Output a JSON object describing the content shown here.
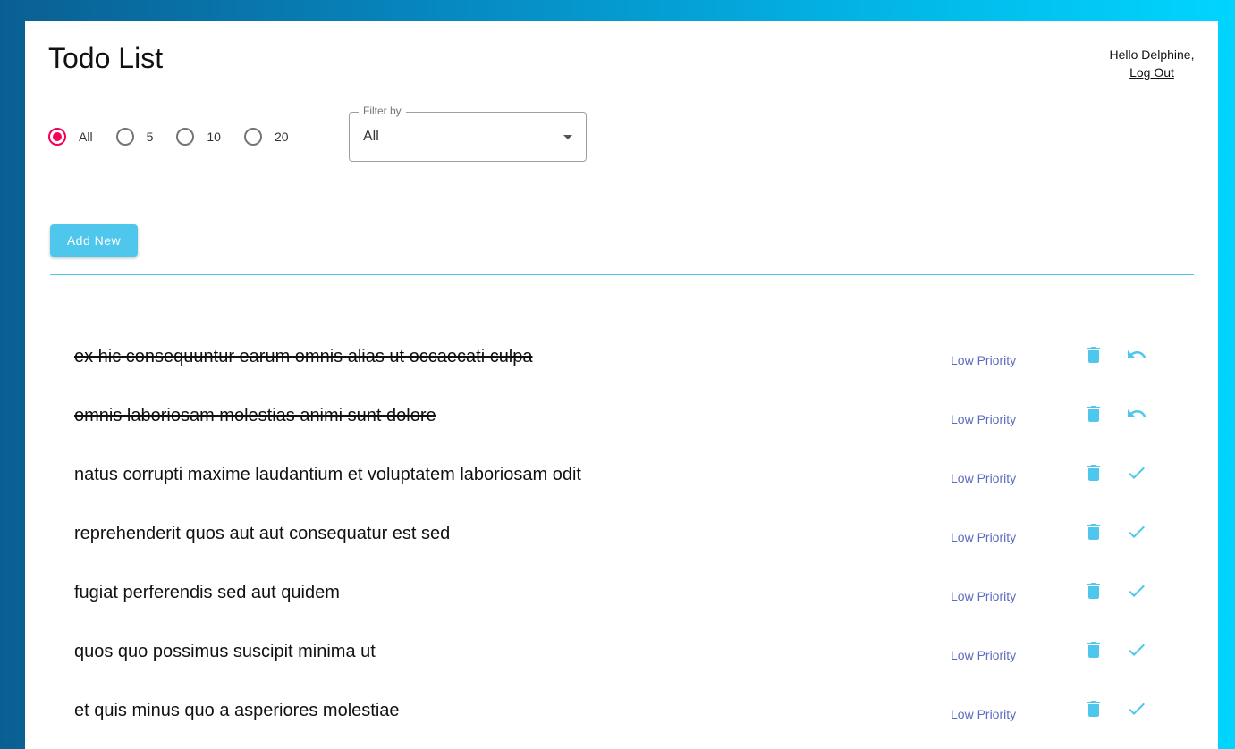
{
  "header": {
    "title": "Todo List",
    "greeting": "Hello Delphine,",
    "logout_label": "Log Out"
  },
  "filters": {
    "radios": [
      {
        "label": "All",
        "checked": true
      },
      {
        "label": "5",
        "checked": false
      },
      {
        "label": "10",
        "checked": false
      },
      {
        "label": "20",
        "checked": false
      }
    ],
    "select": {
      "legend": "Filter by",
      "value": "All"
    }
  },
  "actions": {
    "add_label": "Add New"
  },
  "todos": [
    {
      "text": "ex hic consequuntur earum omnis alias ut occaecati culpa",
      "priority": "Low Priority",
      "completed": true,
      "action_icon": "undo-icon"
    },
    {
      "text": "omnis laboriosam molestias animi sunt dolore",
      "priority": "Low Priority",
      "completed": true,
      "action_icon": "undo-icon"
    },
    {
      "text": "natus corrupti maxime laudantium et voluptatem laboriosam odit",
      "priority": "Low Priority",
      "completed": false,
      "action_icon": "check-icon"
    },
    {
      "text": "reprehenderit quos aut aut consequatur est sed",
      "priority": "Low Priority",
      "completed": false,
      "action_icon": "check-icon"
    },
    {
      "text": "fugiat perferendis sed aut quidem",
      "priority": "Low Priority",
      "completed": false,
      "action_icon": "check-icon"
    },
    {
      "text": "quos quo possimus suscipit minima ut",
      "priority": "Low Priority",
      "completed": false,
      "action_icon": "check-icon"
    },
    {
      "text": "et quis minus quo a asperiores molestiae",
      "priority": "Low Priority",
      "completed": false,
      "action_icon": "check-icon"
    }
  ],
  "colors": {
    "accent": "#4fc6ec",
    "radio_checked": "#f50057",
    "priority_text": "#5c6bc0"
  }
}
